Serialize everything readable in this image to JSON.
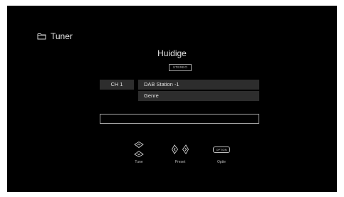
{
  "header": {
    "icon": "folder-icon",
    "title": "Tuner"
  },
  "station": {
    "title": "Huidige",
    "stereo_label": "STEREO",
    "channel": "CH 1",
    "name": "DAB Station -1",
    "genre": "Genre"
  },
  "text_bar": {
    "value": ""
  },
  "controls": {
    "tune": {
      "icon": "up-down-arrows-icon",
      "label": "Tune"
    },
    "preset": {
      "icon": "left-right-arrows-icon",
      "label": "Preset"
    },
    "option": {
      "icon": "option-button-icon",
      "button_text": "OPTION",
      "label": "Optie"
    }
  },
  "colors": {
    "screen_background": "#000000",
    "panel_background": "#2d2d2d",
    "text": "#e0e0e0"
  }
}
